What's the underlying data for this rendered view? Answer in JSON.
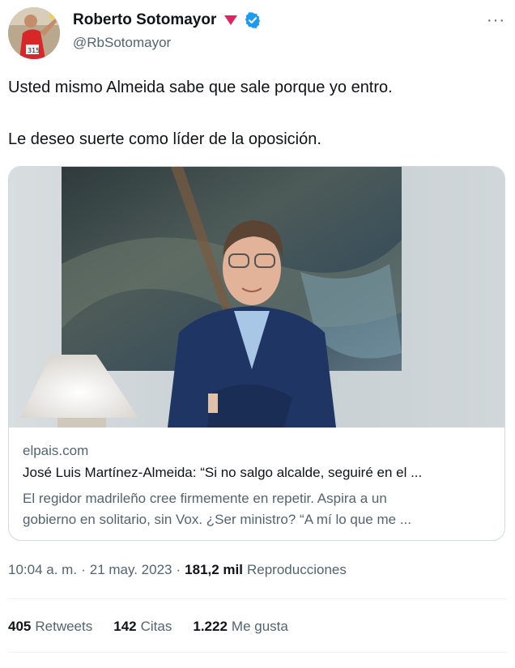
{
  "author": {
    "display_name": "Roberto Sotomayor",
    "handle": "@RbSotomayor",
    "avatar_icon": "runner-avatar",
    "verified_icon": "verified-badge-icon",
    "flag_icon": "red-triangle-icon"
  },
  "more_label": "···",
  "tweet": {
    "line1": "Usted mismo Almeida sabe que sale porque yo entro.",
    "line2": "Le deseo suerte como líder de la oposición."
  },
  "card": {
    "domain": "elpais.com",
    "title": "José Luis Martínez-Almeida: “Si no salgo alcalde, seguiré en el ...",
    "description_line1": "El regidor madrileño cree firmemente en repetir. Aspira a un",
    "description_line2": "gobierno en solitario, sin Vox. ¿Ser ministro? “A mí lo que me ..."
  },
  "meta": {
    "time": "10:04 a. m.",
    "sep1": "·",
    "date": "21 may. 2023",
    "sep2": "·",
    "views_count": "181,2 mil",
    "views_label": "Reproducciones"
  },
  "stats": {
    "retweets_count": "405",
    "retweets_label": "Retweets",
    "quotes_count": "142",
    "quotes_label": "Citas",
    "likes_count": "1.222",
    "likes_label": "Me gusta"
  },
  "colors": {
    "text": "#0f1419",
    "secondary": "#536471",
    "verified": "#1d9bf0",
    "flag": "#e0245e",
    "border": "#cfd9de"
  }
}
